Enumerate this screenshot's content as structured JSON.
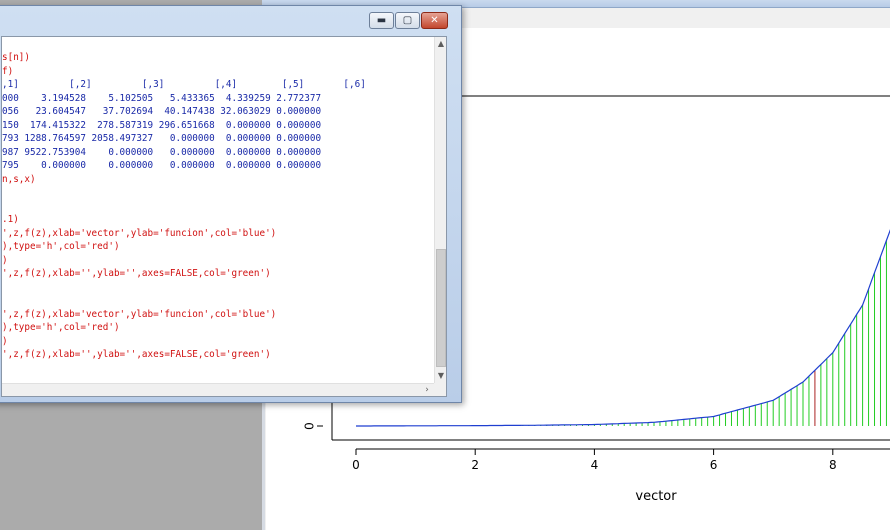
{
  "console": {
    "buttons": {
      "minimize": "▬",
      "maximize": "▢",
      "close": "✕"
    },
    "lines": [
      {
        "text": "s[n])",
        "kind": "in"
      },
      {
        "text": "f)",
        "kind": "in"
      },
      {
        "text": ",1]         [,2]         [,3]         [,4]        [,5]       [,6]",
        "kind": "out"
      },
      {
        "text": "000    3.194528    5.102505   5.433365  4.339259 2.772377",
        "kind": "out"
      },
      {
        "text": "056   23.604547   37.702694  40.147438 32.063029 0.000000",
        "kind": "out"
      },
      {
        "text": "150  174.415322  278.587319 296.651668  0.000000 0.000000",
        "kind": "out"
      },
      {
        "text": "793 1288.764597 2058.497327   0.000000  0.000000 0.000000",
        "kind": "out"
      },
      {
        "text": "987 9522.753904    0.000000   0.000000  0.000000 0.000000",
        "kind": "out"
      },
      {
        "text": "795    0.000000    0.000000   0.000000  0.000000 0.000000",
        "kind": "out"
      },
      {
        "text": "n,s,x)",
        "kind": "in"
      },
      {
        "text": "",
        "kind": "in"
      },
      {
        "text": "",
        "kind": "in"
      },
      {
        "text": ".1)",
        "kind": "in"
      },
      {
        "text": "',z,f(z),xlab='vector',ylab='funcion',col='blue')",
        "kind": "in"
      },
      {
        "text": "),type='h',col='red')",
        "kind": "in"
      },
      {
        "text": ")",
        "kind": "in"
      },
      {
        "text": "',z,f(z),xlab='',ylab='',axes=FALSE,col='green')",
        "kind": "in"
      },
      {
        "text": "",
        "kind": "in"
      },
      {
        "text": "",
        "kind": "in"
      },
      {
        "text": "',z,f(z),xlab='vector',ylab='funcion',col='blue')",
        "kind": "in"
      },
      {
        "text": "),type='h',col='red')",
        "kind": "in"
      },
      {
        "text": ")",
        "kind": "in"
      },
      {
        "text": "',z,f(z),xlab='',ylab='',axes=FALSE,col='green')",
        "kind": "in"
      }
    ],
    "scroll_up_icon": "▲",
    "scroll_down_icon": "▼",
    "scroll_right_icon": "›"
  },
  "plot": {
    "xlabel": "vector",
    "x_ticks": [
      "0",
      "2",
      "4",
      "6",
      "8"
    ],
    "y_ticks": [
      "0"
    ],
    "colors": {
      "curve": "#1f3fd0",
      "spikes_green": "#22cc22",
      "spikes_red": "#aa2222",
      "axis": "#000000"
    }
  },
  "chart_data": {
    "type": "line",
    "title": "",
    "xlabel": "vector",
    "ylabel": "",
    "x_range": [
      0,
      9
    ],
    "ylim": [
      0,
      1
    ],
    "x_ticks": [
      0,
      2,
      4,
      6,
      8
    ],
    "y_ticks": [
      0
    ],
    "curve": "exponential growth, near 0 for x below 5, rising steeply toward x = 9",
    "series": [
      {
        "values_x": [
          0,
          1,
          2,
          3,
          4,
          5,
          6,
          7,
          7.5,
          8,
          8.5,
          9
        ],
        "values_y": [
          0,
          0.0005,
          0.001,
          0.002,
          0.004,
          0.01,
          0.026,
          0.07,
          0.12,
          0.2,
          0.33,
          0.55
        ]
      }
    ]
  }
}
